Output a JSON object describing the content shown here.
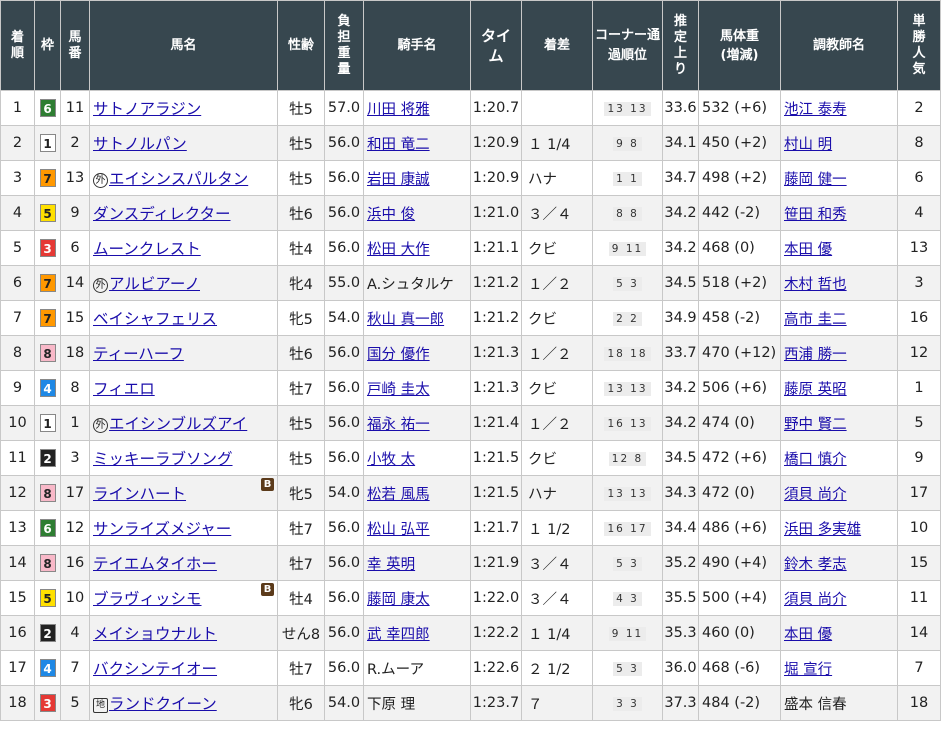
{
  "headers": [
    "着順",
    "枠",
    "馬番",
    "馬名",
    "性齢",
    "負担重量",
    "騎手名",
    "タイム",
    "着差",
    "コーナー通過順位",
    "推定上り",
    "馬体重(増減)",
    "調教師名",
    "単勝人気"
  ],
  "waku_colors": {
    "1": [
      "#ffffff",
      "#222222"
    ],
    "2": [
      "#222222",
      "#ffffff"
    ],
    "3": [
      "#e53935",
      "#ffffff"
    ],
    "4": [
      "#1e88e5",
      "#ffffff"
    ],
    "5": [
      "#ffe000",
      "#222222"
    ],
    "6": [
      "#2e7d32",
      "#ffffff"
    ],
    "7": [
      "#ff9800",
      "#222222"
    ],
    "8": [
      "#f8b8c8",
      "#222222"
    ]
  },
  "rows": [
    {
      "pos": "1",
      "waku": "6",
      "ban": "11",
      "mark": "",
      "horse": "サトノアラジン",
      "blinker": "",
      "sex": "牡5",
      "wt": "57.0",
      "jockey": "川田 将雅",
      "time": "1:20.7",
      "margin": "",
      "corner": "13 13",
      "agari": "33.6",
      "bw": "532 (+6)",
      "trainer": "池江 泰寿",
      "pop": "2"
    },
    {
      "pos": "2",
      "waku": "1",
      "ban": "2",
      "mark": "",
      "horse": "サトノルパン",
      "blinker": "",
      "sex": "牡5",
      "wt": "56.0",
      "jockey": "和田 竜二",
      "time": "1:20.9",
      "margin": "１ 1/4",
      "corner": "9 8",
      "agari": "34.1",
      "bw": "450 (+2)",
      "trainer": "村山 明",
      "pop": "8"
    },
    {
      "pos": "3",
      "waku": "7",
      "ban": "13",
      "mark": "外",
      "horse": "エイシンスパルタン",
      "blinker": "",
      "sex": "牡5",
      "wt": "56.0",
      "jockey": "岩田 康誠",
      "time": "1:20.9",
      "margin": "ハナ",
      "corner": "1 1",
      "agari": "34.7",
      "bw": "498 (+2)",
      "trainer": "藤岡 健一",
      "pop": "6"
    },
    {
      "pos": "4",
      "waku": "5",
      "ban": "9",
      "mark": "",
      "horse": "ダンスディレクター",
      "blinker": "",
      "sex": "牡6",
      "wt": "56.0",
      "jockey": "浜中 俊",
      "time": "1:21.0",
      "margin": "３／４",
      "corner": "8 8",
      "agari": "34.2",
      "bw": "442 (-2)",
      "trainer": "笹田 和秀",
      "pop": "4"
    },
    {
      "pos": "5",
      "waku": "3",
      "ban": "6",
      "mark": "",
      "horse": "ムーンクレスト",
      "blinker": "",
      "sex": "牡4",
      "wt": "56.0",
      "jockey": "松田 大作",
      "time": "1:21.1",
      "margin": "クビ",
      "corner": "9 11",
      "agari": "34.2",
      "bw": "468 (0)",
      "trainer": "本田 優",
      "pop": "13"
    },
    {
      "pos": "6",
      "waku": "7",
      "ban": "14",
      "mark": "外",
      "horse": "アルビアーノ",
      "blinker": "",
      "sex": "牝4",
      "wt": "55.0",
      "jockey": "A.シュタルケ",
      "time": "1:21.2",
      "margin": "１／２",
      "corner": "5 3",
      "agari": "34.5",
      "bw": "518 (+2)",
      "trainer": "木村 哲也",
      "pop": "3"
    },
    {
      "pos": "7",
      "waku": "7",
      "ban": "15",
      "mark": "",
      "horse": "ベイシャフェリス",
      "blinker": "",
      "sex": "牝5",
      "wt": "54.0",
      "jockey": "秋山 真一郎",
      "time": "1:21.2",
      "margin": "クビ",
      "corner": "2 2",
      "agari": "34.9",
      "bw": "458 (-2)",
      "trainer": "高市 圭二",
      "pop": "16"
    },
    {
      "pos": "8",
      "waku": "8",
      "ban": "18",
      "mark": "",
      "horse": "ティーハーフ",
      "blinker": "",
      "sex": "牡6",
      "wt": "56.0",
      "jockey": "国分 優作",
      "time": "1:21.3",
      "margin": "１／２",
      "corner": "18 18",
      "agari": "33.7",
      "bw": "470 (+12)",
      "trainer": "西浦 勝一",
      "pop": "12"
    },
    {
      "pos": "9",
      "waku": "4",
      "ban": "8",
      "mark": "",
      "horse": "フィエロ",
      "blinker": "",
      "sex": "牡7",
      "wt": "56.0",
      "jockey": "戸崎 圭太",
      "time": "1:21.3",
      "margin": "クビ",
      "corner": "13 13",
      "agari": "34.2",
      "bw": "506 (+6)",
      "trainer": "藤原 英昭",
      "pop": "1"
    },
    {
      "pos": "10",
      "waku": "1",
      "ban": "1",
      "mark": "外",
      "horse": "エイシンブルズアイ",
      "blinker": "",
      "sex": "牡5",
      "wt": "56.0",
      "jockey": "福永 祐一",
      "time": "1:21.4",
      "margin": "１／２",
      "corner": "16 13",
      "agari": "34.2",
      "bw": "474 (0)",
      "trainer": "野中 賢二",
      "pop": "5"
    },
    {
      "pos": "11",
      "waku": "2",
      "ban": "3",
      "mark": "",
      "horse": "ミッキーラブソング",
      "blinker": "",
      "sex": "牡5",
      "wt": "56.0",
      "jockey": "小牧 太",
      "time": "1:21.5",
      "margin": "クビ",
      "corner": "12 8",
      "agari": "34.5",
      "bw": "472 (+6)",
      "trainer": "橋口 慎介",
      "pop": "9"
    },
    {
      "pos": "12",
      "waku": "8",
      "ban": "17",
      "mark": "",
      "horse": "ラインハート",
      "blinker": "B",
      "sex": "牝5",
      "wt": "54.0",
      "jockey": "松若 風馬",
      "time": "1:21.5",
      "margin": "ハナ",
      "corner": "13 13",
      "agari": "34.3",
      "bw": "472 (0)",
      "trainer": "須貝 尚介",
      "pop": "17"
    },
    {
      "pos": "13",
      "waku": "6",
      "ban": "12",
      "mark": "",
      "horse": "サンライズメジャー",
      "blinker": "",
      "sex": "牡7",
      "wt": "56.0",
      "jockey": "松山 弘平",
      "time": "1:21.7",
      "margin": "１ 1/2",
      "corner": "16 17",
      "agari": "34.4",
      "bw": "486 (+6)",
      "trainer": "浜田 多実雄",
      "pop": "10"
    },
    {
      "pos": "14",
      "waku": "8",
      "ban": "16",
      "mark": "",
      "horse": "テイエムタイホー",
      "blinker": "",
      "sex": "牡7",
      "wt": "56.0",
      "jockey": "幸 英明",
      "time": "1:21.9",
      "margin": "３／４",
      "corner": "5 3",
      "agari": "35.2",
      "bw": "490 (+4)",
      "trainer": "鈴木 孝志",
      "pop": "15"
    },
    {
      "pos": "15",
      "waku": "5",
      "ban": "10",
      "mark": "",
      "horse": "ブラヴィッシモ",
      "blinker": "B",
      "sex": "牡4",
      "wt": "56.0",
      "jockey": "藤岡 康太",
      "time": "1:22.0",
      "margin": "３／４",
      "corner": "4 3",
      "agari": "35.5",
      "bw": "500 (+4)",
      "trainer": "須貝 尚介",
      "pop": "11"
    },
    {
      "pos": "16",
      "waku": "2",
      "ban": "4",
      "mark": "",
      "horse": "メイショウナルト",
      "blinker": "",
      "sex": "せん8",
      "wt": "56.0",
      "jockey": "武 幸四郎",
      "time": "1:22.2",
      "margin": "１ 1/4",
      "corner": "9 11",
      "agari": "35.3",
      "bw": "460 (0)",
      "trainer": "本田 優",
      "pop": "14"
    },
    {
      "pos": "17",
      "waku": "4",
      "ban": "7",
      "mark": "",
      "horse": "バクシンテイオー",
      "blinker": "",
      "sex": "牡7",
      "wt": "56.0",
      "jockey": "R.ムーア",
      "time": "1:22.6",
      "margin": "２ 1/2",
      "corner": "5 3",
      "agari": "36.0",
      "bw": "468 (-6)",
      "trainer": "堀 宣行",
      "pop": "7"
    },
    {
      "pos": "18",
      "waku": "3",
      "ban": "5",
      "mark": "地",
      "horse": "ランドクイーン",
      "blinker": "",
      "sex": "牝6",
      "wt": "54.0",
      "jockey": "下原 理",
      "time": "1:23.7",
      "margin": "７",
      "corner": "3 3",
      "agari": "37.3",
      "bw": "484 (-2)",
      "trainer": "盛本 信春",
      "pop": "18"
    }
  ]
}
